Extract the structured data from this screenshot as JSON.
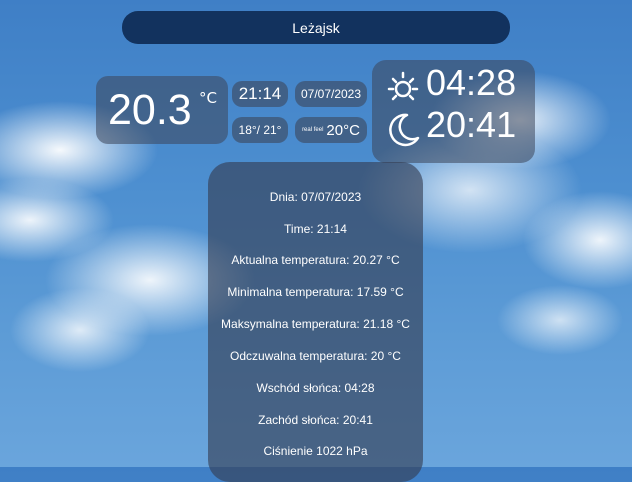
{
  "header": {
    "city": "Leżajsk"
  },
  "current": {
    "temp": "20.3",
    "unit": "°C",
    "time": "21:14",
    "date": "07/07/2023",
    "min_max": "18°/ 21°",
    "real_feel_label": "real feel",
    "real_feel": "20°C"
  },
  "sun": {
    "sunrise": "04:28",
    "sunset": "20:41",
    "sun_icon": "sun-icon",
    "moon_icon": "moon-icon"
  },
  "details": {
    "lines": [
      "Dnia: 07/07/2023",
      "Time: 21:14",
      "Aktualna temperatura: 20.27 °C",
      "Minimalna temperatura: 17.59 °C",
      "Maksymalna temperatura: 21.18 °C",
      "Odczuwalna temperatura: 20 °C",
      "Wschód słońca: 04:28",
      "Zachód słońca: 20:41",
      "Ciśnienie 1022 hPa"
    ]
  },
  "colors": {
    "header_bg": "#12325e",
    "sky": "#4d8fd0"
  }
}
